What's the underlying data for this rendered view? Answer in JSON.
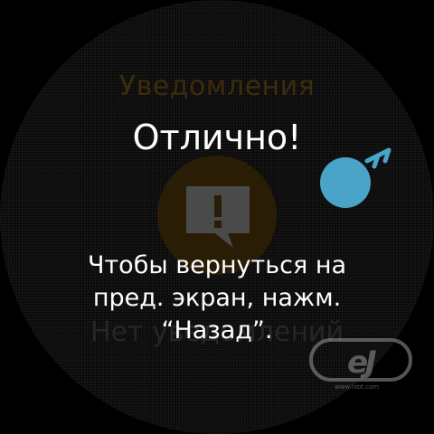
{
  "background": {
    "title": "Уведомления",
    "empty_text": "Нет уведомлений",
    "icon": "notification-alert-icon"
  },
  "tutorial": {
    "heading": "Отлично!",
    "instruction": "Чтобы вернуться на пред. экран, нажм. “Назад”.",
    "gesture_icon": "swipe-gesture-icon"
  },
  "watermark": {
    "text": "www.ixbt.com"
  },
  "colors": {
    "accent": "#f5a623",
    "gesture": "#4aa3c8",
    "text": "#ffffff"
  }
}
